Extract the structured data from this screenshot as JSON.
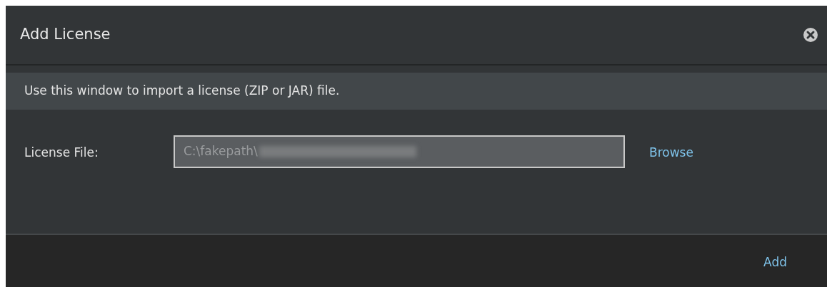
{
  "dialog": {
    "title": "Add License",
    "info": "Use this window to import a license (ZIP or JAR) file.",
    "field": {
      "label": "License File:",
      "value": "C:\\fakepath\\",
      "redacted": true
    },
    "browse": "Browse",
    "buttons": [
      "Add"
    ]
  }
}
